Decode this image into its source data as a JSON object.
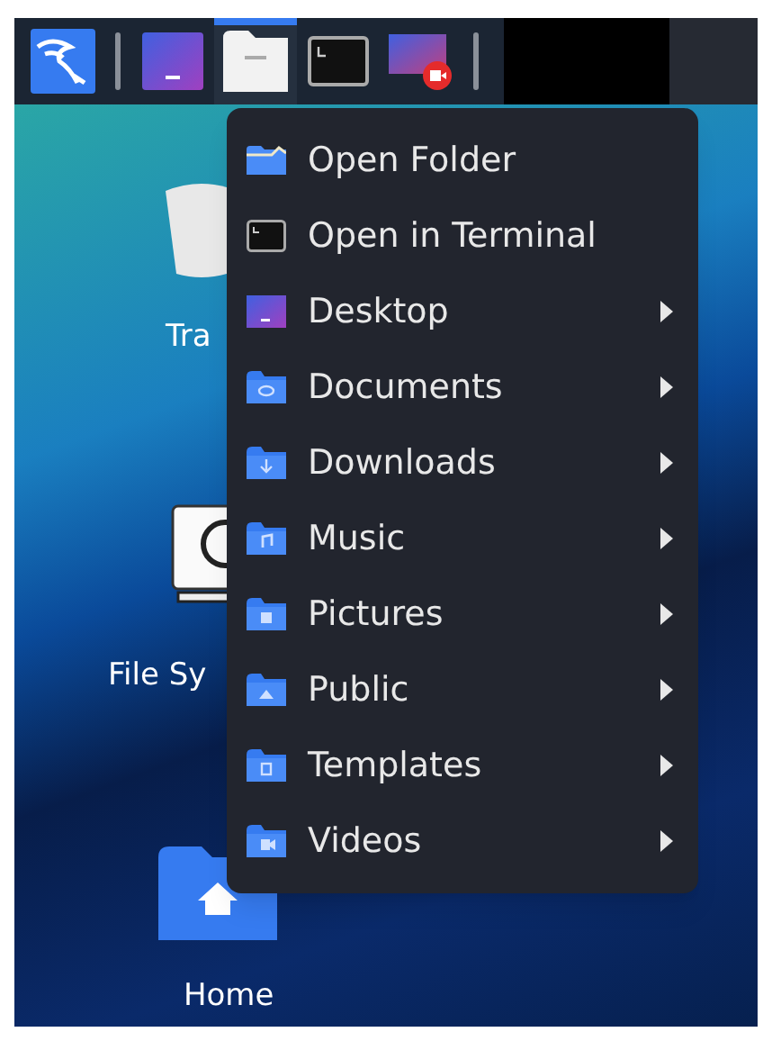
{
  "taskbar": {
    "items": [
      {
        "kind": "logo",
        "selected": false
      },
      {
        "kind": "separator",
        "selected": false
      },
      {
        "kind": "desktop",
        "selected": false
      },
      {
        "kind": "files",
        "selected": true
      },
      {
        "kind": "terminal",
        "selected": false
      },
      {
        "kind": "recorder",
        "selected": false
      },
      {
        "kind": "separator",
        "selected": false
      }
    ]
  },
  "desktop_icons": [
    {
      "kind": "trash",
      "label": "Tra"
    },
    {
      "kind": "drive",
      "label": "File Sy"
    },
    {
      "kind": "home",
      "label": "Home"
    }
  ],
  "context_menu": {
    "items": [
      {
        "kind": "folder-open",
        "label": "Open Folder",
        "submenu": false
      },
      {
        "kind": "terminal",
        "label": "Open in Terminal",
        "submenu": false
      },
      {
        "kind": "desktop",
        "label": "Desktop",
        "submenu": true
      },
      {
        "kind": "documents",
        "label": "Documents",
        "submenu": true
      },
      {
        "kind": "downloads",
        "label": "Downloads",
        "submenu": true
      },
      {
        "kind": "music",
        "label": "Music",
        "submenu": true
      },
      {
        "kind": "pictures",
        "label": "Pictures",
        "submenu": true
      },
      {
        "kind": "public",
        "label": "Public",
        "submenu": true
      },
      {
        "kind": "templates",
        "label": "Templates",
        "submenu": true
      },
      {
        "kind": "videos",
        "label": "Videos",
        "submenu": true
      }
    ]
  }
}
